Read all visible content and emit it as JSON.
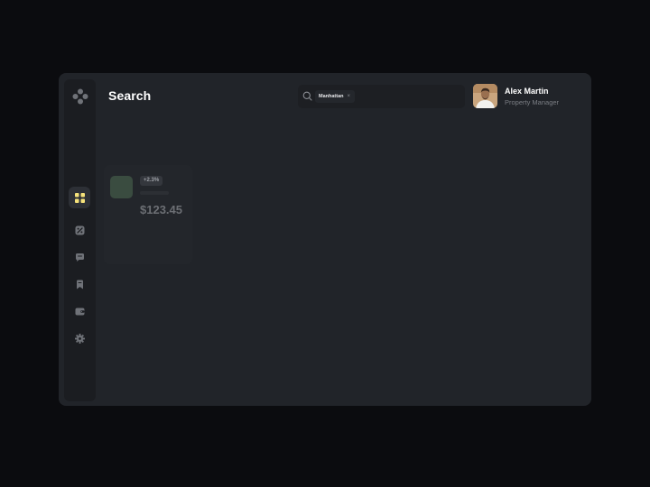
{
  "header": {
    "title": "Search"
  },
  "search": {
    "chip_label": "Manhattan",
    "chip_close": "×",
    "placeholder": ""
  },
  "user": {
    "name": "Alex Martin",
    "role": "Property Manager"
  },
  "stat_card": {
    "change": "+2.3%",
    "value": "$123.45"
  },
  "sidebar": {
    "items": [
      {
        "icon": "dashboard-grid-icon",
        "active": true
      },
      {
        "icon": "chart-card-icon",
        "active": false
      },
      {
        "icon": "message-icon",
        "active": false
      },
      {
        "icon": "bookmark-icon",
        "active": false
      },
      {
        "icon": "wallet-icon",
        "active": false
      },
      {
        "icon": "settings-gear-icon",
        "active": false
      }
    ]
  },
  "colors": {
    "background": "#0b0c0f",
    "window": "#212429",
    "sidebar": "#1b1d21",
    "accent_yellow": "#f5e27a"
  }
}
